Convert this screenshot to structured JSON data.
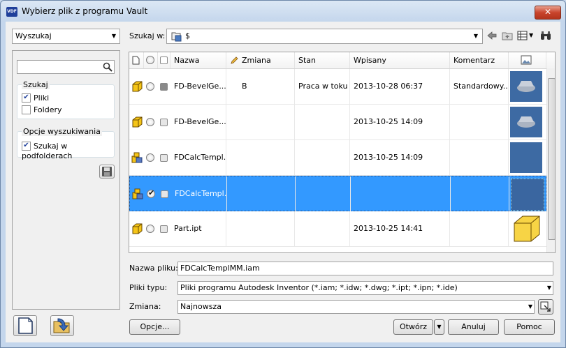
{
  "window": {
    "title": "Wybierz plik z programu Vault",
    "app_icon_text": "VDF",
    "close_symbol": "✕"
  },
  "left": {
    "mode_combo": "Wyszukaj",
    "search_placeholder": "",
    "group_search": {
      "legend": "Szukaj",
      "options": [
        {
          "label": "Pliki",
          "checked": true
        },
        {
          "label": "Foldery",
          "checked": false
        }
      ]
    },
    "group_options": {
      "legend": "Opcje wyszukiwania",
      "options": [
        {
          "label": "Szukaj w podfolderach",
          "checked": true
        }
      ]
    }
  },
  "path": {
    "label": "Szukaj w:",
    "value": "$"
  },
  "grid": {
    "columns": [
      "Nazwa",
      "Zmiana",
      "Stan",
      "Wpisany",
      "Komentarz"
    ],
    "rows": [
      {
        "name": "FD-BevelGe...",
        "revision": "B",
        "state": "Praca w toku",
        "checked_in": "2013-10-28 06:37",
        "comment": "Standardowy...",
        "icon": "part-icon",
        "selected": false,
        "checked": false
      },
      {
        "name": "FD-BevelGe...",
        "revision": "",
        "state": "",
        "checked_in": "2013-10-25 14:09",
        "comment": "",
        "icon": "part-icon",
        "selected": false,
        "checked": false
      },
      {
        "name": "FDCalcTempl...",
        "revision": "",
        "state": "",
        "checked_in": "2013-10-25 14:09",
        "comment": "",
        "icon": "assembly-icon",
        "selected": false,
        "checked": false
      },
      {
        "name": "FDCalcTempl...",
        "revision": "",
        "state": "",
        "checked_in": "",
        "comment": "",
        "icon": "assembly-icon",
        "selected": true,
        "checked": true
      },
      {
        "name": "Part.ipt",
        "revision": "",
        "state": "",
        "checked_in": "2013-10-25 14:41",
        "comment": "",
        "icon": "part-icon",
        "selected": false,
        "checked": false
      }
    ]
  },
  "form": {
    "filename_label": "Nazwa pliku:",
    "filename_value": "FDCalcTemplMM.iam",
    "filetype_label": "Pliki typu:",
    "filetype_value": "Pliki programu Autodesk Inventor (*.iam; *.idw; *.dwg; *.ipt; *.ipn; *.ide)",
    "revision_label": "Zmiana:",
    "revision_value": "Najnowsza"
  },
  "buttons": {
    "options": "Opcje...",
    "open": "Otwórz",
    "cancel": "Anuluj",
    "help": "Pomoc"
  },
  "colors": {
    "selection": "#3399ff",
    "thumbnail_bg": "#3d6aa3",
    "part_yellow": "#f5c518"
  }
}
